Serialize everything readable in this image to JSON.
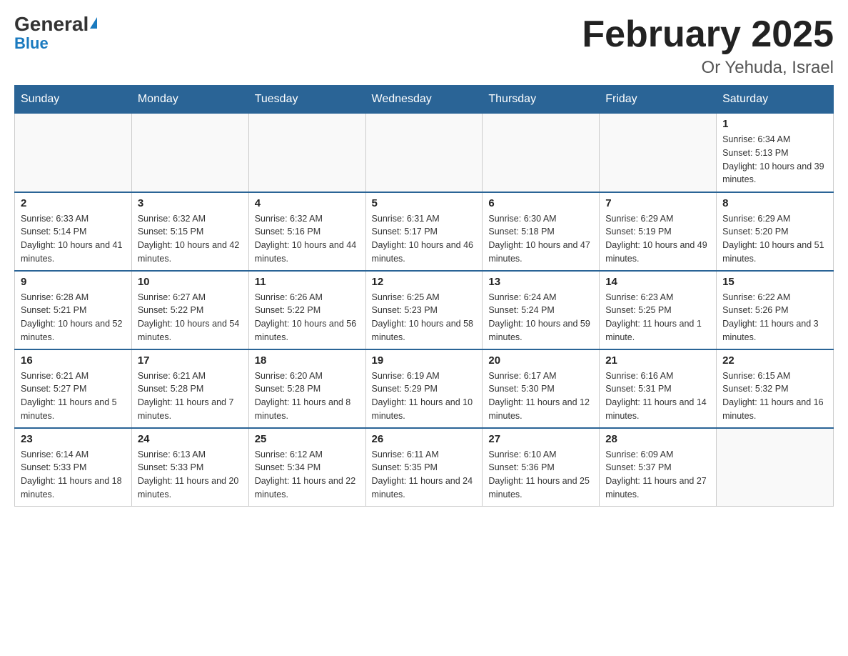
{
  "header": {
    "logo_general": "General",
    "logo_blue": "Blue",
    "month_title": "February 2025",
    "location": "Or Yehuda, Israel"
  },
  "weekdays": [
    "Sunday",
    "Monday",
    "Tuesday",
    "Wednesday",
    "Thursday",
    "Friday",
    "Saturday"
  ],
  "weeks": [
    [
      {
        "day": "",
        "info": ""
      },
      {
        "day": "",
        "info": ""
      },
      {
        "day": "",
        "info": ""
      },
      {
        "day": "",
        "info": ""
      },
      {
        "day": "",
        "info": ""
      },
      {
        "day": "",
        "info": ""
      },
      {
        "day": "1",
        "info": "Sunrise: 6:34 AM\nSunset: 5:13 PM\nDaylight: 10 hours and 39 minutes."
      }
    ],
    [
      {
        "day": "2",
        "info": "Sunrise: 6:33 AM\nSunset: 5:14 PM\nDaylight: 10 hours and 41 minutes."
      },
      {
        "day": "3",
        "info": "Sunrise: 6:32 AM\nSunset: 5:15 PM\nDaylight: 10 hours and 42 minutes."
      },
      {
        "day": "4",
        "info": "Sunrise: 6:32 AM\nSunset: 5:16 PM\nDaylight: 10 hours and 44 minutes."
      },
      {
        "day": "5",
        "info": "Sunrise: 6:31 AM\nSunset: 5:17 PM\nDaylight: 10 hours and 46 minutes."
      },
      {
        "day": "6",
        "info": "Sunrise: 6:30 AM\nSunset: 5:18 PM\nDaylight: 10 hours and 47 minutes."
      },
      {
        "day": "7",
        "info": "Sunrise: 6:29 AM\nSunset: 5:19 PM\nDaylight: 10 hours and 49 minutes."
      },
      {
        "day": "8",
        "info": "Sunrise: 6:29 AM\nSunset: 5:20 PM\nDaylight: 10 hours and 51 minutes."
      }
    ],
    [
      {
        "day": "9",
        "info": "Sunrise: 6:28 AM\nSunset: 5:21 PM\nDaylight: 10 hours and 52 minutes."
      },
      {
        "day": "10",
        "info": "Sunrise: 6:27 AM\nSunset: 5:22 PM\nDaylight: 10 hours and 54 minutes."
      },
      {
        "day": "11",
        "info": "Sunrise: 6:26 AM\nSunset: 5:22 PM\nDaylight: 10 hours and 56 minutes."
      },
      {
        "day": "12",
        "info": "Sunrise: 6:25 AM\nSunset: 5:23 PM\nDaylight: 10 hours and 58 minutes."
      },
      {
        "day": "13",
        "info": "Sunrise: 6:24 AM\nSunset: 5:24 PM\nDaylight: 10 hours and 59 minutes."
      },
      {
        "day": "14",
        "info": "Sunrise: 6:23 AM\nSunset: 5:25 PM\nDaylight: 11 hours and 1 minute."
      },
      {
        "day": "15",
        "info": "Sunrise: 6:22 AM\nSunset: 5:26 PM\nDaylight: 11 hours and 3 minutes."
      }
    ],
    [
      {
        "day": "16",
        "info": "Sunrise: 6:21 AM\nSunset: 5:27 PM\nDaylight: 11 hours and 5 minutes."
      },
      {
        "day": "17",
        "info": "Sunrise: 6:21 AM\nSunset: 5:28 PM\nDaylight: 11 hours and 7 minutes."
      },
      {
        "day": "18",
        "info": "Sunrise: 6:20 AM\nSunset: 5:28 PM\nDaylight: 11 hours and 8 minutes."
      },
      {
        "day": "19",
        "info": "Sunrise: 6:19 AM\nSunset: 5:29 PM\nDaylight: 11 hours and 10 minutes."
      },
      {
        "day": "20",
        "info": "Sunrise: 6:17 AM\nSunset: 5:30 PM\nDaylight: 11 hours and 12 minutes."
      },
      {
        "day": "21",
        "info": "Sunrise: 6:16 AM\nSunset: 5:31 PM\nDaylight: 11 hours and 14 minutes."
      },
      {
        "day": "22",
        "info": "Sunrise: 6:15 AM\nSunset: 5:32 PM\nDaylight: 11 hours and 16 minutes."
      }
    ],
    [
      {
        "day": "23",
        "info": "Sunrise: 6:14 AM\nSunset: 5:33 PM\nDaylight: 11 hours and 18 minutes."
      },
      {
        "day": "24",
        "info": "Sunrise: 6:13 AM\nSunset: 5:33 PM\nDaylight: 11 hours and 20 minutes."
      },
      {
        "day": "25",
        "info": "Sunrise: 6:12 AM\nSunset: 5:34 PM\nDaylight: 11 hours and 22 minutes."
      },
      {
        "day": "26",
        "info": "Sunrise: 6:11 AM\nSunset: 5:35 PM\nDaylight: 11 hours and 24 minutes."
      },
      {
        "day": "27",
        "info": "Sunrise: 6:10 AM\nSunset: 5:36 PM\nDaylight: 11 hours and 25 minutes."
      },
      {
        "day": "28",
        "info": "Sunrise: 6:09 AM\nSunset: 5:37 PM\nDaylight: 11 hours and 27 minutes."
      },
      {
        "day": "",
        "info": ""
      }
    ]
  ]
}
